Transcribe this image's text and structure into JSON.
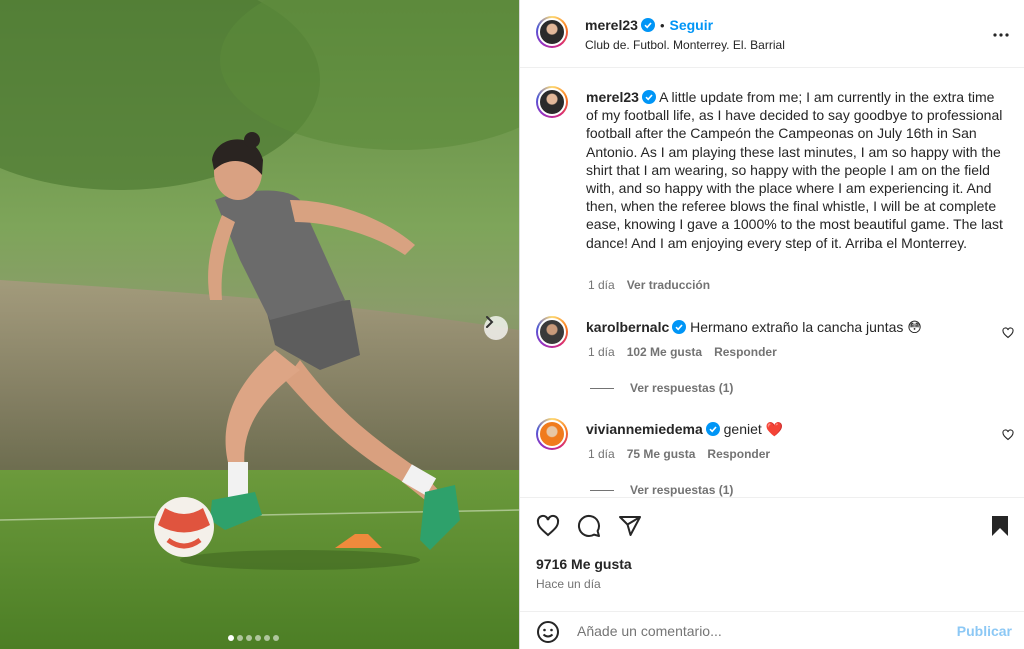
{
  "icons": {
    "verified": "verified-badge-icon",
    "more": "more-options-icon",
    "next": "chevron-right-icon",
    "like": "heart-icon",
    "comment": "comment-bubble-icon",
    "share": "paper-plane-icon",
    "save": "bookmark-icon",
    "emoji": "emoji-smile-icon"
  },
  "colors": {
    "accent": "#0095f6",
    "verified": "#0095f6",
    "heart_emoji": "#e0245e"
  },
  "media": {
    "slide_count": 6,
    "active_slide": 1
  },
  "header": {
    "username": "merel23",
    "bullet": "•",
    "follow_label": "Seguir",
    "location": "Club de. Futbol. Monterrey. El. Barrial"
  },
  "caption": {
    "username": "merel23",
    "text": "A little update from me; I am currently in the extra time of my football life, as I have decided to say goodbye to professional football after the Campeón the Campeonas on July 16th in San Antonio. As I am playing these last minutes, I am so happy with the shirt that I am wearing, so happy with the people I am on the field with, and so happy with the place where I am experiencing it. And then, when the referee blows the final whistle, I will be at complete ease, knowing I gave a 1000% to the most beautiful game. The last dance! And I am enjoying every step of it. Arriba el Monterrey.",
    "time": "1 día",
    "translate_label": "Ver traducción"
  },
  "comments": [
    {
      "username": "karolbernalc",
      "text": "Hermano extraño la cancha juntas 😳",
      "time": "1 día",
      "likes": "102 Me gusta",
      "reply_label": "Responder",
      "view_replies": "Ver respuestas (1)"
    },
    {
      "username": "viviannemiedema",
      "text": "geniet ❤️",
      "time": "1 día",
      "likes": "75 Me gusta",
      "reply_label": "Responder",
      "view_replies": "Ver respuestas (1)"
    }
  ],
  "footer": {
    "likes": "9716 Me gusta",
    "posted": "Hace un día",
    "comment_placeholder": "Añade un comentario...",
    "publish_label": "Publicar"
  }
}
